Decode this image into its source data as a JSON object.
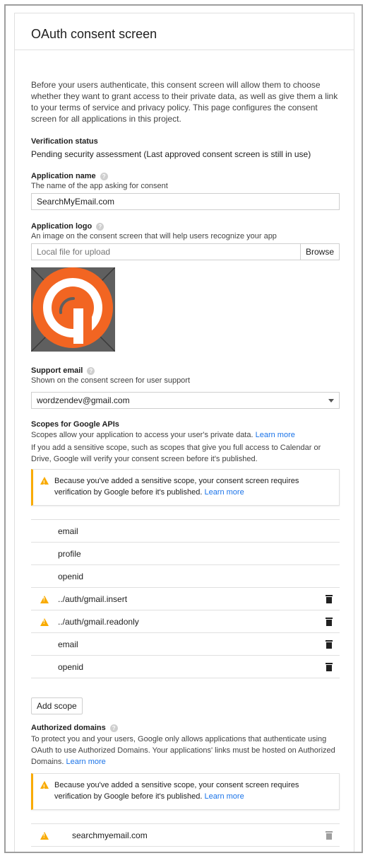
{
  "page": {
    "title": "OAuth consent screen",
    "intro": "Before your users authenticate, this consent screen will allow them to choose whether they want to grant access to their private data, as well as give them a link to your terms of service and privacy policy. This page configures the consent screen for all applications in this project."
  },
  "verification": {
    "label": "Verification status",
    "value": "Pending security assessment (Last approved consent screen is still in use)"
  },
  "app_name": {
    "label": "Application name",
    "hint": "The name of the app asking for consent",
    "value": "SearchMyEmail.com"
  },
  "app_logo": {
    "label": "Application logo",
    "hint": "An image on the consent screen that will help users recognize your app",
    "placeholder": "Local file for upload",
    "browse_label": "Browse"
  },
  "support_email": {
    "label": "Support email",
    "hint": "Shown on the consent screen for user support",
    "value": "wordzendev@gmail.com"
  },
  "scopes": {
    "label": "Scopes for Google APIs",
    "hint": "Scopes allow your application to access your user's private data.",
    "hint_link": "Learn more",
    "note": "If you add a sensitive scope, such as scopes that give you full access to Calendar or Drive, Google will verify your consent screen before it's published.",
    "warning": "Because you've added a sensitive scope, your consent screen requires verification by Google before it's published.",
    "warning_link": "Learn more",
    "items": [
      {
        "name": "email",
        "warn": false,
        "delete": false
      },
      {
        "name": "profile",
        "warn": false,
        "delete": false
      },
      {
        "name": "openid",
        "warn": false,
        "delete": false
      },
      {
        "name": "../auth/gmail.insert",
        "warn": true,
        "delete": true
      },
      {
        "name": "../auth/gmail.readonly",
        "warn": true,
        "delete": true
      },
      {
        "name": "email",
        "warn": false,
        "delete": true
      },
      {
        "name": "openid",
        "warn": false,
        "delete": true
      }
    ],
    "add_label": "Add scope"
  },
  "domains": {
    "label": "Authorized domains",
    "hint": "To protect you and your users, Google only allows applications that authenticate using OAuth to use Authorized Domains. Your applications' links must be hosted on Authorized Domains.",
    "hint_link": "Learn more",
    "warning": "Because you've added a sensitive scope, your consent screen requires verification by Google before it's published.",
    "warning_link": "Learn more",
    "items": [
      {
        "name": "searchmyemail.com"
      }
    ]
  },
  "colors": {
    "accent_link": "#1a73e8",
    "warning": "#f9ab00",
    "logo_orange": "#f26522"
  }
}
